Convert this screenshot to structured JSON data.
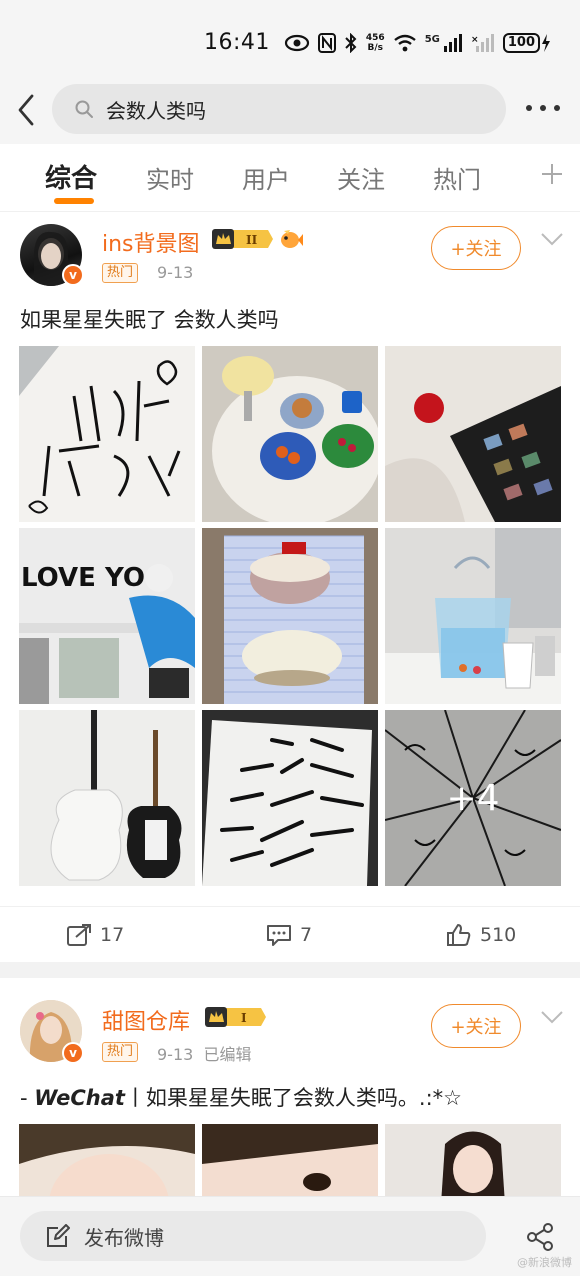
{
  "status_bar": {
    "time": "16:41",
    "net_speed_value": "456",
    "net_speed_unit": "B/s",
    "network": "5G",
    "battery": "100"
  },
  "search": {
    "query": "会数人类吗"
  },
  "tabs": [
    {
      "label": "综合",
      "active": true
    },
    {
      "label": "实时",
      "active": false
    },
    {
      "label": "用户",
      "active": false
    },
    {
      "label": "关注",
      "active": false
    },
    {
      "label": "热门",
      "active": false
    }
  ],
  "posts": [
    {
      "author": "ins背景图",
      "level_label": "II",
      "hot_tag": "热门",
      "meta": "9-13",
      "follow_label": "+关注",
      "text": "如果星星失眠了 会数人类吗",
      "images": [
        {
          "desc_icon": "handwritten-note-image"
        },
        {
          "desc_icon": "food-table-image"
        },
        {
          "desc_icon": "apple-tablet-image"
        },
        {
          "desc_icon": "love-you-wall-image"
        },
        {
          "desc_icon": "teacup-blanket-image"
        },
        {
          "desc_icon": "glass-bag-image"
        },
        {
          "desc_icon": "guitars-image"
        },
        {
          "desc_icon": "book-page-image"
        },
        {
          "desc_icon": "umbrella-image"
        }
      ],
      "more_count": "+4",
      "stats": {
        "reposts": "17",
        "comments": "7",
        "likes": "510"
      }
    },
    {
      "author": "甜图仓库",
      "level_label": "I",
      "hot_tag": "热门",
      "meta": "9-13  已编辑",
      "follow_label": "+关注",
      "text_prefix": "- ",
      "text_bold": "WeChat",
      "text_rest": "丨如果星星失眠了会数人类吗。.:*☆"
    }
  ],
  "compose": {
    "label": "发布微博"
  },
  "watermark": "@新浪微博",
  "colors": {
    "accent": "#f26b1d",
    "tab_underline": "#ff8200",
    "follow": "#f08a2c"
  }
}
